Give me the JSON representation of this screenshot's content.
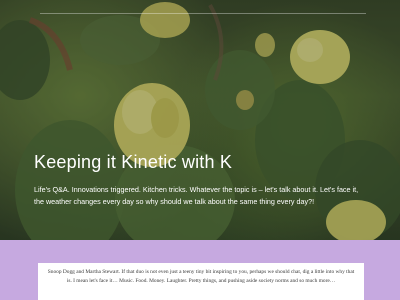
{
  "hero": {
    "title": "Keeping it Kinetic with K",
    "tagline": "Life's Q&A. Innovations triggered. Kitchen tricks. Whatever the topic is – let's talk about it. Let's face it, the weather changes every day so why should we talk about the same thing every day?!"
  },
  "intro": {
    "text": "Snoop Dogg and Martha Stewart. If that duo is not even just a teeny tiny bit inspiring to you, perhaps we should chat, dig a little into why that is. I mean let's face it… Music. Food. Money. Laughter. Pretty things, and pushing aside society norms and so much more…"
  },
  "colors": {
    "band": "#c6a9e0",
    "card": "#ffffff",
    "flower": "#e6e07a"
  }
}
